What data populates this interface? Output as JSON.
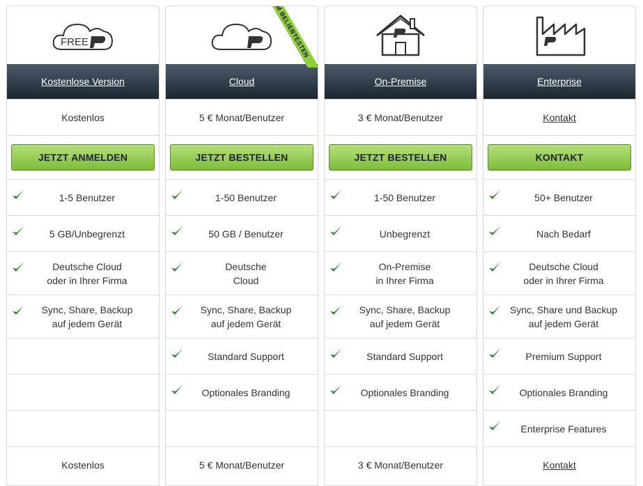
{
  "badge": "AM BELIEBTESTEN",
  "columns": [
    {
      "logo_text": "FREE",
      "title": "Kostenlose Version",
      "price": "Kostenlos",
      "price_is_link": false,
      "button": "JETZT ANMELDEN",
      "features": [
        "1-5 Benutzer",
        "5 GB/Unbegrenzt",
        "Deutsche Cloud\noder in Ihrer Firma",
        "Sync, Share, Backup\nauf jedem Gerät",
        "",
        "",
        ""
      ],
      "footer_price": "Kostenlos"
    },
    {
      "logo_text": "",
      "title": "Cloud",
      "price": "5 € Monat/Benutzer",
      "price_is_link": false,
      "button": "JETZT BESTELLEN",
      "features": [
        "1-50 Benutzer",
        "50 GB / Benutzer",
        "Deutsche\nCloud",
        "Sync, Share, Backup\nauf jedem Gerät",
        "Standard Support",
        "Optionales Branding",
        ""
      ],
      "footer_price": "5 € Monat/Benutzer"
    },
    {
      "logo_text": "",
      "title": "On-Premise",
      "price": "3 € Monat/Benutzer",
      "price_is_link": false,
      "button": "JETZT BESTELLEN",
      "features": [
        "1-50 Benutzer",
        "Unbegrenzt",
        "On-Premise\nin Ihrer Firma",
        "Sync, Share, Backup\nauf jedem Gerät",
        "Standard Support",
        "Optionales Branding",
        ""
      ],
      "footer_price": "3 € Monat/Benutzer"
    },
    {
      "logo_text": "",
      "title": "Enterprise",
      "price": "Kontakt",
      "price_is_link": true,
      "button": "KONTAKT",
      "features": [
        "50+ Benutzer",
        "Nach Bedarf",
        "Deutsche Cloud\noder in Ihrer Firma",
        "Sync, Share und Backup\nauf jedem Gerät",
        "Premium Support",
        "Optionales Branding",
        "Enterprise Features"
      ],
      "footer_price": "Kontakt"
    }
  ],
  "icons": [
    "cloud-free-logo-icon",
    "cloud-logo-icon",
    "house-logo-icon",
    "factory-logo-icon",
    "checkmark-icon"
  ],
  "colors": {
    "button_green": "#8ecf3a",
    "header_dark": "#1b2632",
    "check_green": "#2e8b2e"
  }
}
